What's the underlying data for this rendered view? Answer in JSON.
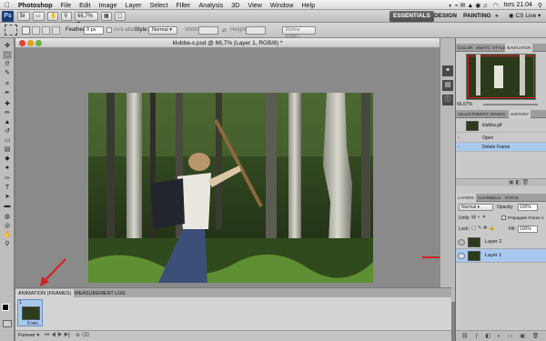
{
  "menubar": {
    "apple": "",
    "app_name": "Photoshop",
    "items": [
      "File",
      "Edit",
      "Image",
      "Layer",
      "Select",
      "Filter",
      "Analysis",
      "3D",
      "View",
      "Window",
      "Help"
    ],
    "clock": "tors 21.04"
  },
  "appbar": {
    "logo": "Ps",
    "zoom": "66,7%",
    "workspaces": [
      "ESSENTIALS",
      "DESIGN",
      "PAINTING"
    ],
    "more": "»",
    "cs_live": "CS Live"
  },
  "options": {
    "feather_label": "Feather:",
    "feather_value": "0 px",
    "antialias_label": "Anti-alias",
    "style_label": "Style:",
    "style_value": "Normal",
    "width_label": "Width:",
    "height_label": "Height:",
    "refine_edge": "Refine Edge..."
  },
  "document": {
    "title": "klubba-s.psd @ 66,7% (Layer 1, RGB/8) *"
  },
  "animation": {
    "tabs": [
      "ANIMATION (FRAMES)",
      "MEASUREMENT LOG"
    ],
    "frame_number": "1",
    "frame_delay": "0 sec.",
    "loop": "Forever"
  },
  "navigator_panel": {
    "tabs": [
      "COLOR",
      "SWATC",
      "STYLE",
      "NAVIGATOR"
    ],
    "zoom": "66,67%"
  },
  "history_panel": {
    "tabs": [
      "ADJUSTMENTS",
      "MASKS",
      "HISTORY"
    ],
    "snapshot": "klubba.gif",
    "items": [
      "Open",
      "Delete Frame"
    ],
    "selected_index": 1
  },
  "layers_panel": {
    "tabs": [
      "LAYERS",
      "CHANNELS",
      "PATHS"
    ],
    "blend_mode": "Normal",
    "opacity_label": "Opacity:",
    "opacity_value": "100%",
    "unify_label": "Unify:",
    "propagate_label": "Propagate Frame 1",
    "lock_label": "Lock:",
    "fill_label": "Fill:",
    "fill_value": "100%",
    "layers": [
      "Layer 2",
      "Layer 1"
    ],
    "selected_index": 1
  },
  "colors": {
    "accent_selection": "#a9c8ee",
    "arrow_red": "#d42020"
  }
}
